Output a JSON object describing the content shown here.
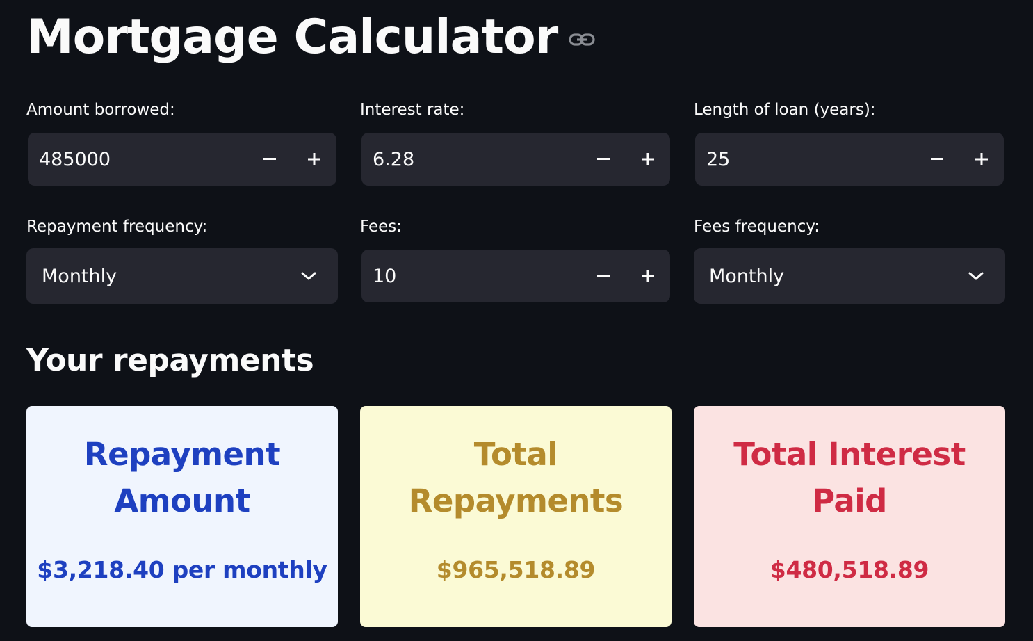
{
  "header": {
    "title": "Mortgage Calculator",
    "anchor_icon": "link-icon"
  },
  "inputs": {
    "amount_borrowed": {
      "label": "Amount borrowed:",
      "value": "485000"
    },
    "interest_rate": {
      "label": "Interest rate:",
      "value": "6.28"
    },
    "loan_length": {
      "label": "Length of loan (years):",
      "value": "25"
    },
    "repayment_frequency": {
      "label": "Repayment frequency:",
      "value": "Monthly"
    },
    "fees": {
      "label": "Fees:",
      "value": "10"
    },
    "fees_frequency": {
      "label": "Fees frequency:",
      "value": "Monthly"
    },
    "decrement_symbol": "−",
    "increment_symbol": "+"
  },
  "results": {
    "heading": "Your repayments",
    "repayment_amount": {
      "title_line1": "Repayment",
      "title_line2": "Amount",
      "value": "$3,218.40 per monthly",
      "bg_color": "#f0f5fe",
      "text_color": "#1e40c0"
    },
    "total_repayments": {
      "title_line1": "Total",
      "title_line2": "Repayments",
      "value": "$965,518.89",
      "bg_color": "#fbfad5",
      "text_color": "#b48b2c"
    },
    "total_interest": {
      "title_line1": "Total Interest",
      "title_line2": "Paid",
      "value": "$480,518.89",
      "bg_color": "#fbe3e2",
      "text_color": "#cf2b44"
    }
  },
  "colors": {
    "background": "#0e1117",
    "input_bg": "#262730",
    "text": "#fafafa"
  }
}
